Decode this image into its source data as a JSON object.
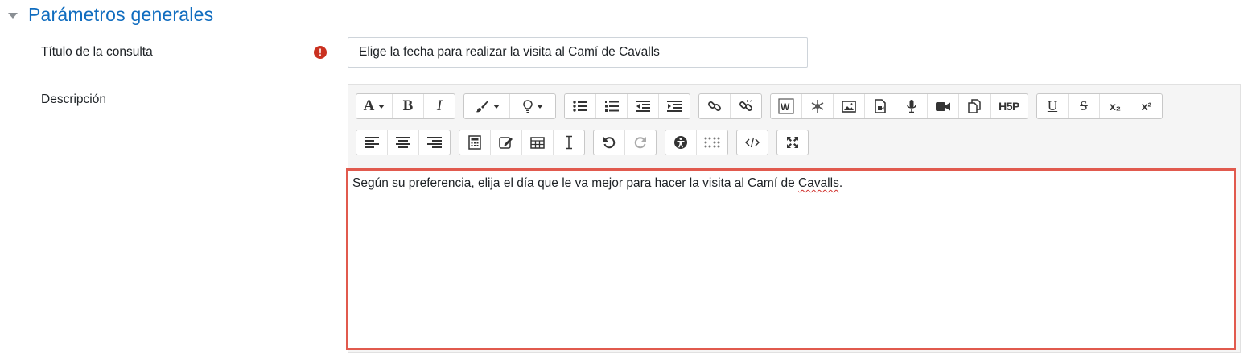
{
  "section": {
    "title": "Parámetros generales"
  },
  "form": {
    "title_label": "Título de la consulta",
    "title_value": "Elige la fecha para realizar la visita al Camí de Cavalls",
    "required_icon": "!",
    "description_label": "Descripción"
  },
  "editor": {
    "content_before": "Según su preferencia, elija el día que le va mejor para hacer la visita al Camí de ",
    "content_misspelled": "Cavalls",
    "content_after": ".",
    "toolbar": {
      "font_label": "A",
      "bold_label": "B",
      "italic_label": "I",
      "h5p_label": "H5P",
      "underline_label": "U",
      "strike_label": "S",
      "subscript_label": "x₂",
      "superscript_label": "x²"
    }
  },
  "colors": {
    "accent": "#0f6cbf",
    "required": "#ca3120",
    "highlight_border": "#e15a4e"
  }
}
